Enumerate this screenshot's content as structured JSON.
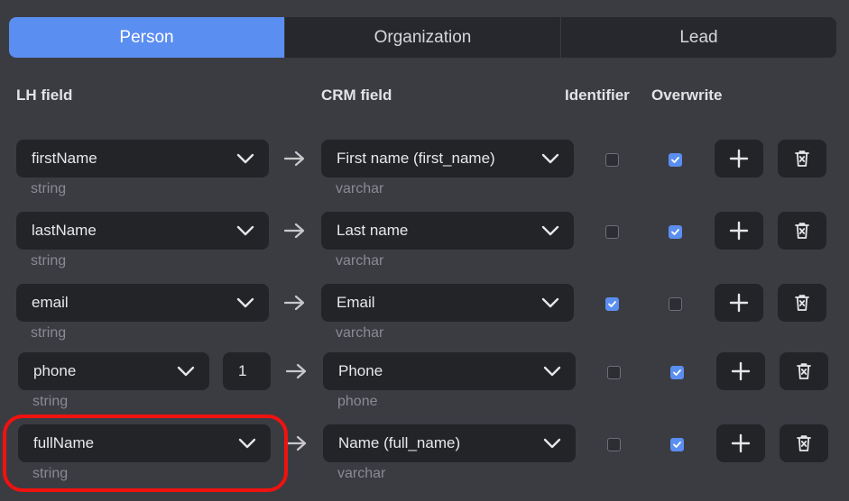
{
  "tabs": [
    {
      "label": "Person",
      "active": true
    },
    {
      "label": "Organization",
      "active": false
    },
    {
      "label": "Lead",
      "active": false
    }
  ],
  "headers": {
    "lh_field": "LH field",
    "crm_field": "CRM field",
    "identifier": "Identifier",
    "overwrite": "Overwrite"
  },
  "rows": [
    {
      "lh": "firstName",
      "lh_type": "string",
      "crm": "First name (first_name)",
      "crm_type": "varchar",
      "identifier": false,
      "overwrite": true
    },
    {
      "lh": "lastName",
      "lh_type": "string",
      "crm": "Last name",
      "crm_type": "varchar",
      "identifier": false,
      "overwrite": true
    },
    {
      "lh": "email",
      "lh_type": "string",
      "crm": "Email",
      "crm_type": "varchar",
      "identifier": true,
      "overwrite": false
    },
    {
      "lh": "phone",
      "lh_type": "string",
      "index": "1",
      "crm": "Phone",
      "crm_type": "phone",
      "identifier": false,
      "overwrite": true
    },
    {
      "lh": "fullName",
      "lh_type": "string",
      "crm": "Name (full_name)",
      "crm_type": "varchar",
      "identifier": false,
      "overwrite": true
    }
  ],
  "icons": {
    "add": "plus-icon",
    "delete": "trash-icon",
    "dropdown": "chevron-down-icon",
    "map": "arrow-right-icon"
  },
  "colors": {
    "accent": "#5b8ef1",
    "highlight": "#f0120f",
    "background": "#3b3c42",
    "control": "#232428"
  }
}
